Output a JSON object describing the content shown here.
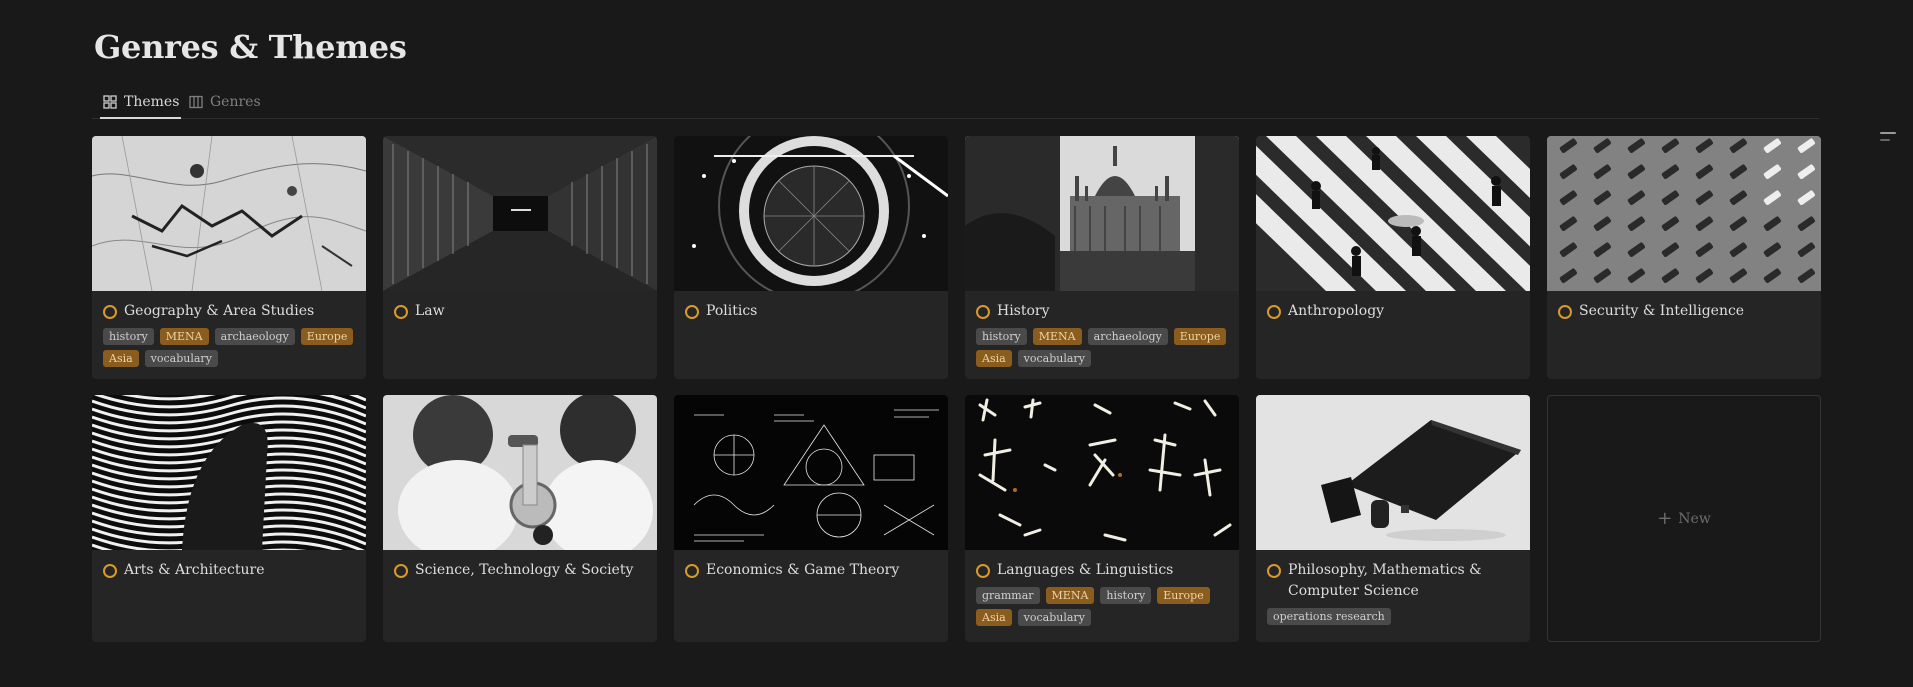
{
  "page": {
    "title": "Genres & Themes"
  },
  "tabs": [
    {
      "label": "Themes",
      "icon": "gallery-icon",
      "active": true
    },
    {
      "label": "Genres",
      "icon": "table-icon",
      "active": false
    }
  ],
  "cards": [
    {
      "title": "Geography & Area Studies",
      "image": "map-photo",
      "tags": [
        {
          "label": "history",
          "color": "gray"
        },
        {
          "label": "MENA",
          "color": "gold"
        },
        {
          "label": "archaeology",
          "color": "gray"
        },
        {
          "label": "Europe",
          "color": "gold"
        },
        {
          "label": "Asia",
          "color": "gold"
        },
        {
          "label": "vocabulary",
          "color": "gray"
        }
      ]
    },
    {
      "title": "Law",
      "image": "prison-corridor-photo",
      "tags": []
    },
    {
      "title": "Politics",
      "image": "dome-interior-photo",
      "tags": []
    },
    {
      "title": "History",
      "image": "parliament-photo",
      "tags": [
        {
          "label": "history",
          "color": "gray"
        },
        {
          "label": "MENA",
          "color": "gold"
        },
        {
          "label": "archaeology",
          "color": "gray"
        },
        {
          "label": "Europe",
          "color": "gold"
        },
        {
          "label": "Asia",
          "color": "gold"
        },
        {
          "label": "vocabulary",
          "color": "gray"
        }
      ]
    },
    {
      "title": "Anthropology",
      "image": "crosswalk-photo",
      "tags": []
    },
    {
      "title": "Security & Intelligence",
      "image": "cctv-cameras-photo",
      "tags": []
    },
    {
      "title": "Arts & Architecture",
      "image": "op-art-photo",
      "tags": []
    },
    {
      "title": "Science, Technology & Society",
      "image": "microscope-photo",
      "tags": []
    },
    {
      "title": "Economics & Game Theory",
      "image": "chalkboard-photo",
      "tags": []
    },
    {
      "title": "Languages & Linguistics",
      "image": "calligraphy-photo",
      "tags": [
        {
          "label": "grammar",
          "color": "gray"
        },
        {
          "label": "MENA",
          "color": "gold"
        },
        {
          "label": "history",
          "color": "gray"
        },
        {
          "label": "Europe",
          "color": "gold"
        },
        {
          "label": "Asia",
          "color": "gold"
        },
        {
          "label": "vocabulary",
          "color": "gray"
        }
      ]
    },
    {
      "title": "Philosophy, Mathematics & Computer Science",
      "image": "laptop-photo",
      "tags": [
        {
          "label": "operations research",
          "color": "gray"
        }
      ]
    }
  ],
  "new_card": {
    "label": "New",
    "icon": "plus-icon"
  },
  "colors": {
    "status_ring": "#d89a2c",
    "tag_gold": "#8a5d1f",
    "tag_gray": "#4a4a4a"
  }
}
